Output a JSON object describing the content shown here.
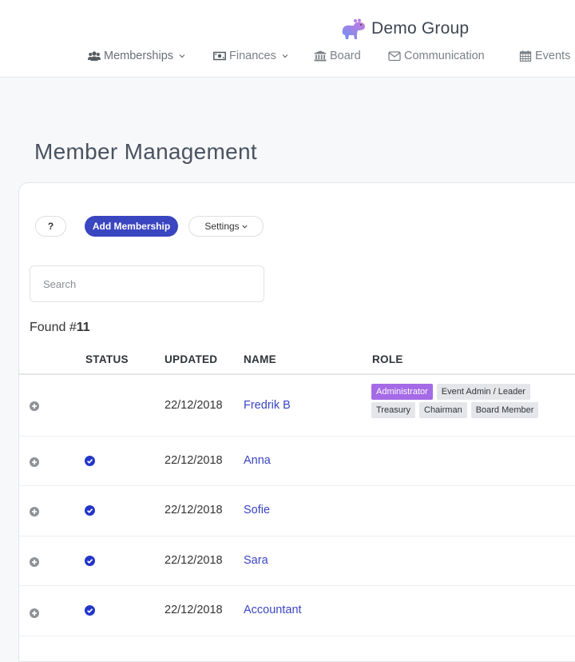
{
  "brand": {
    "logo_icon": "hippo-logo",
    "name": "Demo Group"
  },
  "nav": {
    "items": [
      {
        "label": "Memberships",
        "icon": "users-icon",
        "dropdown": true
      },
      {
        "label": "Finances",
        "icon": "money-bill-icon",
        "dropdown": true
      },
      {
        "label": "Board",
        "icon": "bank-icon",
        "dropdown": false
      },
      {
        "label": "Communication",
        "icon": "envelope-icon",
        "dropdown": false
      },
      {
        "label": "Events",
        "icon": "calendar-icon",
        "dropdown": false
      }
    ]
  },
  "page": {
    "title": "Member Management"
  },
  "toolbar": {
    "help_label": "?",
    "add_label": "Add Membership",
    "settings_label": "Settings"
  },
  "search": {
    "placeholder": "Search",
    "value": ""
  },
  "results": {
    "prefix": "Found #",
    "count": "11"
  },
  "table": {
    "headers": {
      "status": "STATUS",
      "updated": "UPDATED",
      "name": "NAME",
      "role": "ROLE"
    },
    "rows": [
      {
        "status": "",
        "updated": "22/12/2018",
        "name": "Fredrik B",
        "roles": [
          "Administrator",
          "Event Admin / Leader",
          "Treasury",
          "Chairman",
          "Board Member"
        ]
      },
      {
        "status": "verified",
        "updated": "22/12/2018",
        "name": "Anna",
        "roles": []
      },
      {
        "status": "verified",
        "updated": "22/12/2018",
        "name": "Sofie",
        "roles": []
      },
      {
        "status": "verified",
        "updated": "22/12/2018",
        "name": "Sara",
        "roles": []
      },
      {
        "status": "verified",
        "updated": "22/12/2018",
        "name": "Accountant",
        "roles": []
      }
    ]
  },
  "colors": {
    "primary": "#3a45c0",
    "admin_badge": "#a56ae6",
    "badge": "#e4e6ea",
    "title": "#4a5360"
  }
}
